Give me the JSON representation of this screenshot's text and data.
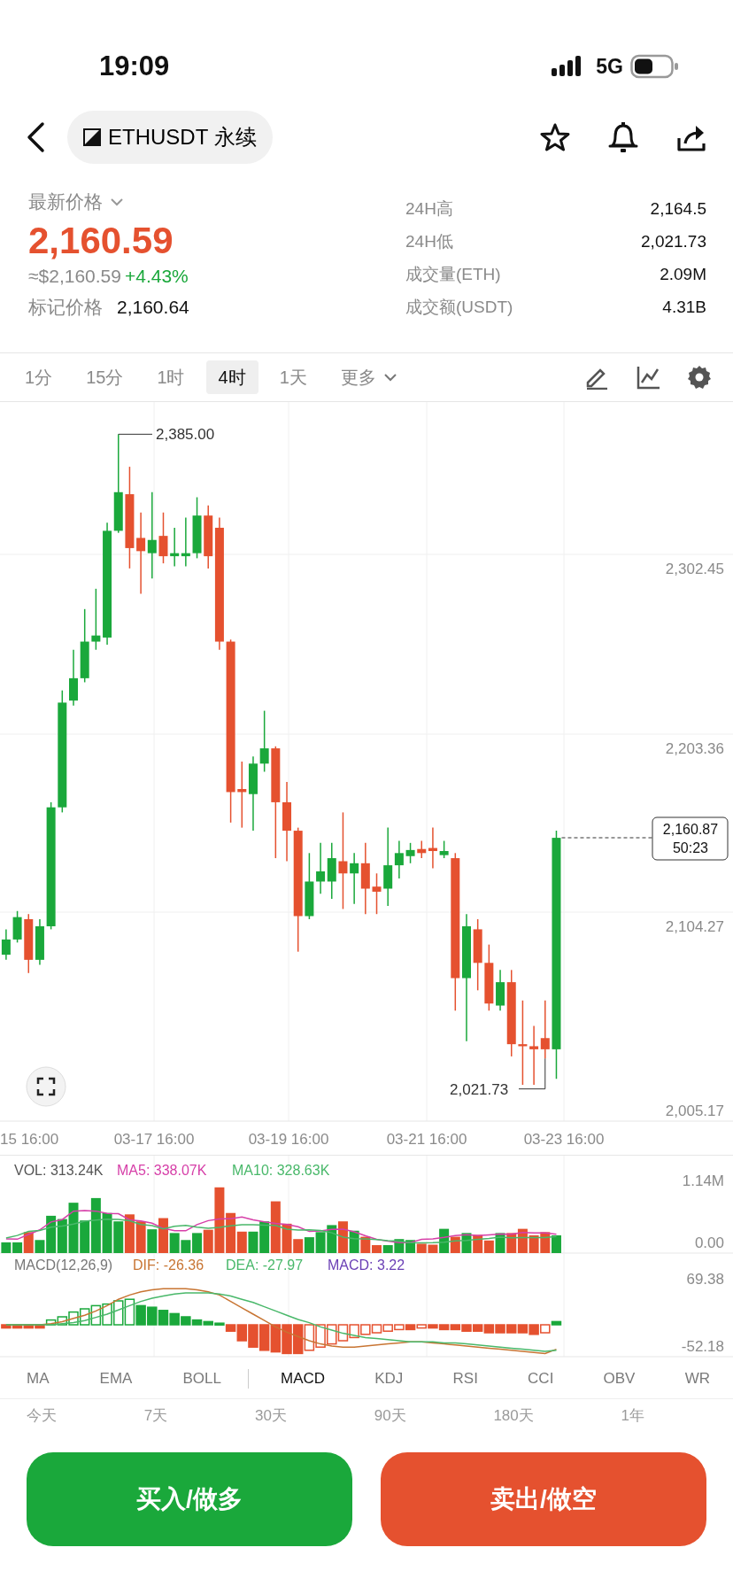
{
  "status_bar": {
    "time": "19:09",
    "network": "5G"
  },
  "header": {
    "pair": "ETHUSDT 永续"
  },
  "price": {
    "label": "最新价格",
    "last": "2,160.59",
    "approx": "≈$2,160.59",
    "change": "+4.43%",
    "mark_label": "标记价格",
    "mark": "2,160.64"
  },
  "stats": [
    {
      "label": "24H高",
      "value": "2,164.5"
    },
    {
      "label": "24H低",
      "value": "2,021.73"
    },
    {
      "label": "成交量(ETH)",
      "value": "2.09M"
    },
    {
      "label": "成交额(USDT)",
      "value": "4.31B"
    }
  ],
  "timeframes": [
    {
      "label": "1分",
      "selected": false
    },
    {
      "label": "15分",
      "selected": false
    },
    {
      "label": "1时",
      "selected": false
    },
    {
      "label": "4时",
      "selected": true
    },
    {
      "label": "1天",
      "selected": false
    }
  ],
  "more": "更多",
  "chart": {
    "y_labels": [
      "2,302.45",
      "2,203.36",
      "2,104.27",
      "2,005.17"
    ],
    "high_label": "2,385.00",
    "low_label": "2,021.73",
    "current_price": "2,160.87",
    "countdown": "50:23",
    "x_labels": [
      "15 16:00",
      "03-17 16:00",
      "03-19 16:00",
      "03-21 16:00",
      "03-23 16:00"
    ]
  },
  "volume": {
    "legend": [
      "VOL: 313.24K",
      "MA5: 338.07K",
      "MA10: 328.63K"
    ],
    "y_labels": [
      "1.14M",
      "0.00"
    ]
  },
  "macd": {
    "legend": [
      "MACD(12,26,9)",
      "DIF: -26.36",
      "DEA: -27.97",
      "MACD: 3.22"
    ],
    "y_labels": [
      "69.38",
      "-52.18"
    ]
  },
  "main_indicators": [
    {
      "label": "MA",
      "selected": false
    },
    {
      "label": "EMA",
      "selected": false
    },
    {
      "label": "BOLL",
      "selected": false
    }
  ],
  "sub_indicators": [
    {
      "label": "MACD",
      "selected": true
    },
    {
      "label": "KDJ",
      "selected": false
    },
    {
      "label": "RSI",
      "selected": false
    },
    {
      "label": "CCI",
      "selected": false
    },
    {
      "label": "OBV",
      "selected": false
    },
    {
      "label": "WR",
      "selected": false
    }
  ],
  "ranges": [
    "今天",
    "7天",
    "30天",
    "90天",
    "180天",
    "1年"
  ],
  "buttons": {
    "buy": "买入/做多",
    "sell": "卖出/做空"
  }
}
